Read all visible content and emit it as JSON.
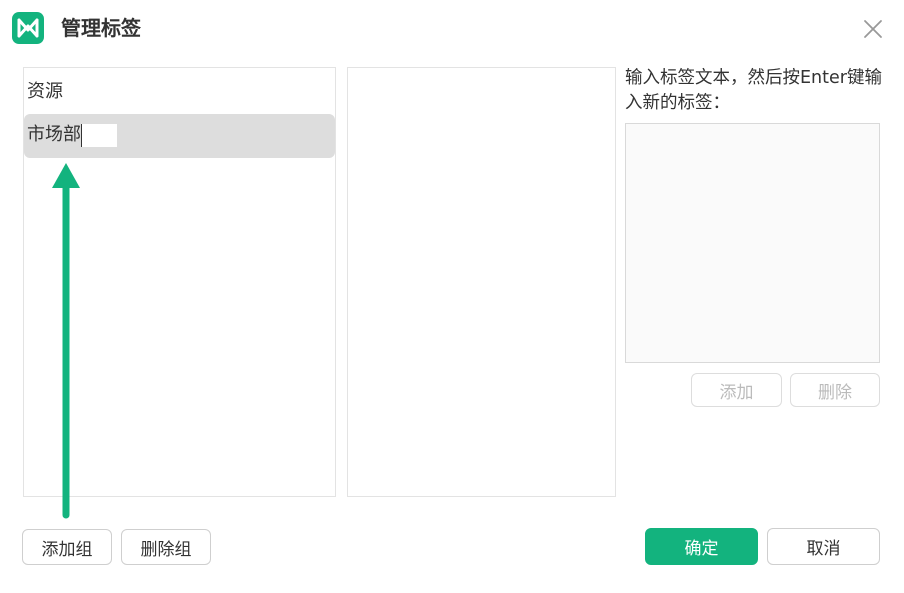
{
  "dialog": {
    "title": "管理标签",
    "close_label": "×"
  },
  "groups": {
    "header": "资源",
    "editing_value": "市场部"
  },
  "tag_editor": {
    "hint": "输入标签文本，然后按Enter键输入新的标签：",
    "input_value": "",
    "add_label": "添加",
    "delete_label": "删除"
  },
  "footer": {
    "add_group_label": "添加组",
    "delete_group_label": "删除组",
    "ok_label": "确定",
    "cancel_label": "取消"
  },
  "colors": {
    "brand": "#13b37e",
    "selection": "#dddddd",
    "annotation_arrow": "#13b37e"
  },
  "icons": {
    "logo": "mindmaster-logo-icon",
    "close": "close-icon",
    "annotation": "arrow-up-icon"
  }
}
